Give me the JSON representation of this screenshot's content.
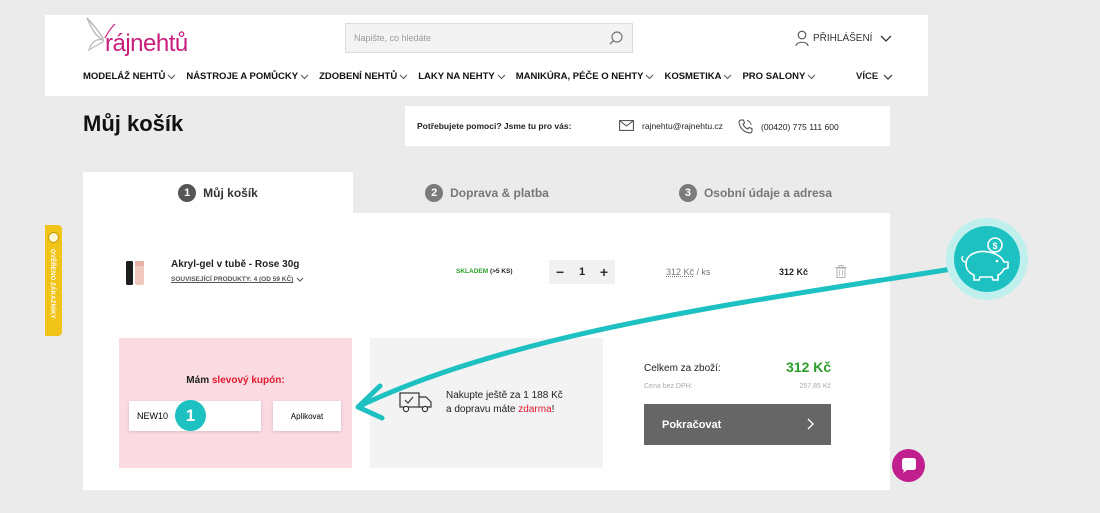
{
  "logo": {
    "raj": "ráj",
    "nehtu": "nehtů"
  },
  "search": {
    "placeholder": "Napište, co hledáte"
  },
  "header": {
    "login_label": "PŘIHLÁŠENÍ"
  },
  "nav": {
    "items": [
      {
        "label": "MODELÁŽ NEHTŮ"
      },
      {
        "label": "NÁSTROJE A POMŮCKY"
      },
      {
        "label": "ZDOBENÍ NEHTŮ"
      },
      {
        "label": "LAKY NA NEHTY"
      },
      {
        "label": "MANIKÚRA, PÉČE O NEHTY"
      },
      {
        "label": "KOSMETIKA"
      },
      {
        "label": "PRO SALONY"
      }
    ],
    "more_label": "VÍCE"
  },
  "page": {
    "title": "Můj košík"
  },
  "help": {
    "question": "Potřebujete pomoci? Jsme tu pro vás:",
    "email": "rajnehtu@rajnehtu.cz",
    "phone": "(00420) 775 111 600"
  },
  "steps": [
    {
      "num": "1",
      "label": "Můj košík"
    },
    {
      "num": "2",
      "label": "Doprava & platba"
    },
    {
      "num": "3",
      "label": "Osobní údaje a adresa"
    }
  ],
  "cart": {
    "item": {
      "name": "Akryl-gel v tubě - Rose 30g",
      "related": "SOUVISEJÍCÍ PRODUKTY: 4 (OD 59 KČ)",
      "stock_status": "SKLADEM",
      "stock_detail": "(>5 KS)",
      "quantity": "1",
      "unit_price": "312 Kč",
      "unit_suffix": "/ ks",
      "total": "312 Kč"
    }
  },
  "coupon": {
    "prefix": "Mám",
    "highlight": "slevový kupón:",
    "value": "NEW10",
    "apply_label": "Aplikovat",
    "step_marker": "1"
  },
  "shipping": {
    "line1_prefix": "Nakupte ještě za",
    "line1_amount": "1 188 Kč",
    "line2_prefix": "a dopravu máte",
    "line2_highlight": "zdarma",
    "line2_suffix": "!"
  },
  "summary": {
    "total_label": "Celkem za zboží:",
    "total_value": "312 Kč",
    "novat_label": "Cena bez DPH:",
    "novat_value": "257,85 Kč",
    "continue_label": "Pokračovat"
  },
  "badge": {
    "text": "OVĚŘENO ZÁKAZNÍKY"
  },
  "colors": {
    "brand": "#c81e7d",
    "teal": "#1ec1c1",
    "green": "#2a9d2a",
    "coupon_bg": "#fadbe1",
    "red": "#e0192e"
  }
}
